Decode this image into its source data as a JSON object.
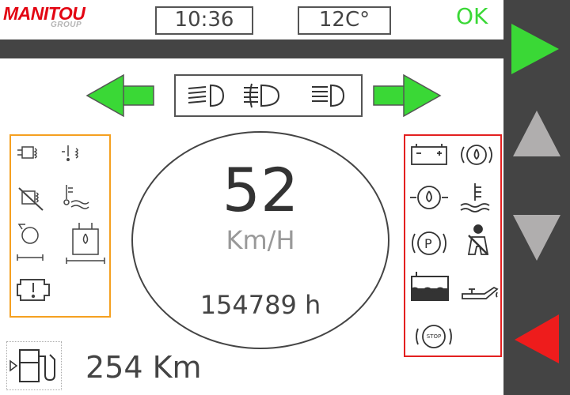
{
  "header": {
    "logo_text": "MANITOU",
    "logo_subtext": "GROUP",
    "time": "10:36",
    "temperature": "12C°",
    "status": "OK"
  },
  "colors": {
    "accent_green": "#3ad836",
    "warning_red": "#e32020",
    "indicator_orange": "#f5a020",
    "panel_dark": "#444444"
  },
  "lights_panel": {
    "icons": [
      "low-beam-headlight-icon",
      "fog-light-icon",
      "high-beam-headlight-icon"
    ]
  },
  "turn_indicators": {
    "left": "left-turn-arrow-icon",
    "right": "right-turn-arrow-icon"
  },
  "dashboard": {
    "speed": "52",
    "speed_unit": "Km/H",
    "hours": "154789 h",
    "fuel_range": "254 Km"
  },
  "indicators_left": {
    "icons": [
      "preheat-icon",
      "engine-warning-icon",
      "diesel-filter-off-icon",
      "temperature-gauge-icon",
      "transmission-icon",
      "hydraulic-oil-icon",
      "engine-fault-icon"
    ]
  },
  "indicators_right": {
    "icons": [
      "battery-icon",
      "brake-fluid-icon",
      "engine-oil-pressure-icon",
      "coolant-temperature-icon",
      "parking-brake-icon",
      "seatbelt-icon",
      "coolant-level-icon",
      "oil-can-icon",
      "stop-icon"
    ],
    "stop_label": "STOP"
  },
  "nav": {
    "buttons": [
      "play-right-icon",
      "scroll-up-icon",
      "scroll-down-icon",
      "back-left-icon"
    ]
  }
}
